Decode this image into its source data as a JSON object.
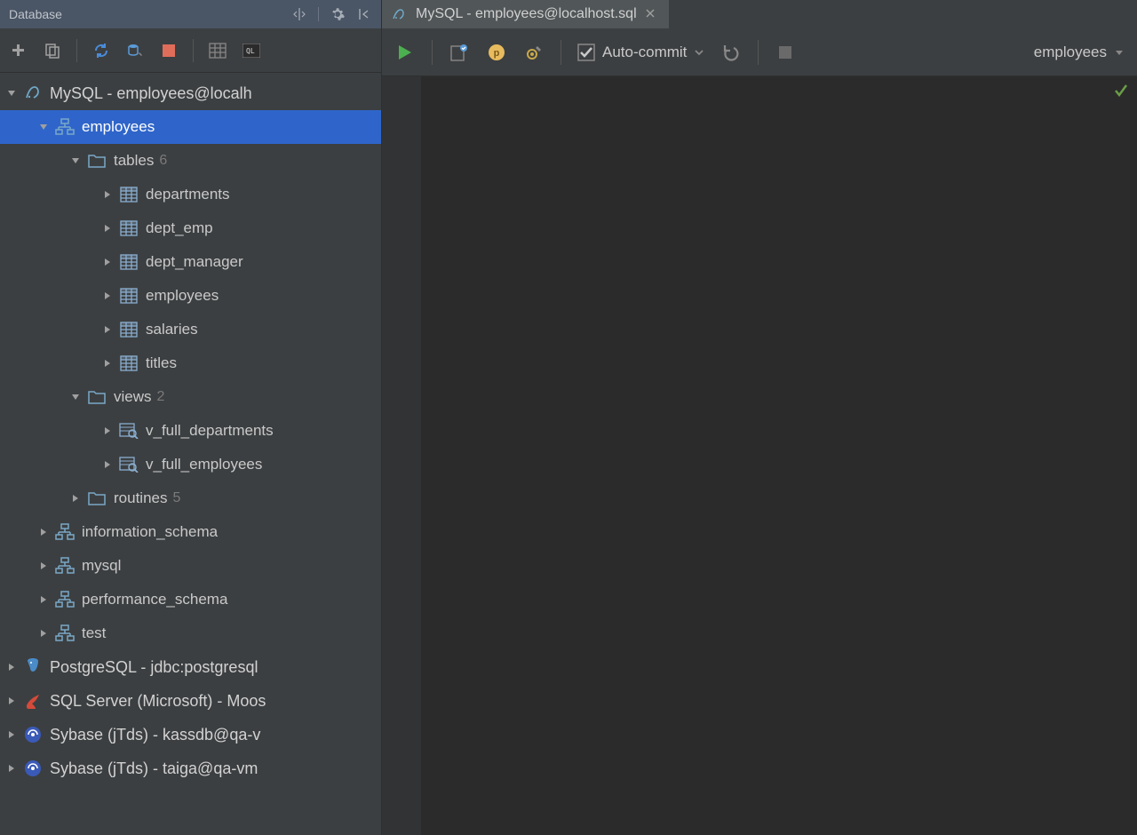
{
  "panel": {
    "title": "Database"
  },
  "tree": {
    "connections": [
      {
        "name": "MySQL - employees@localh",
        "icon": "mysql",
        "expanded": true,
        "schemas": [
          {
            "name": "employees",
            "selected": true,
            "expanded": true,
            "folders": [
              {
                "name": "tables",
                "count": "6",
                "expanded": true,
                "items": [
                  {
                    "name": "departments",
                    "type": "table"
                  },
                  {
                    "name": "dept_emp",
                    "type": "table"
                  },
                  {
                    "name": "dept_manager",
                    "type": "table"
                  },
                  {
                    "name": "employees",
                    "type": "table"
                  },
                  {
                    "name": "salaries",
                    "type": "table"
                  },
                  {
                    "name": "titles",
                    "type": "table"
                  }
                ]
              },
              {
                "name": "views",
                "count": "2",
                "expanded": true,
                "items": [
                  {
                    "name": "v_full_departments",
                    "type": "view"
                  },
                  {
                    "name": "v_full_employees",
                    "type": "view"
                  }
                ]
              },
              {
                "name": "routines",
                "count": "5",
                "expanded": false,
                "items": []
              }
            ]
          },
          {
            "name": "information_schema"
          },
          {
            "name": "mysql"
          },
          {
            "name": "performance_schema"
          },
          {
            "name": "test"
          }
        ]
      },
      {
        "name": "PostgreSQL - jdbc:postgresql",
        "icon": "postgres"
      },
      {
        "name": "SQL Server (Microsoft) - Moos",
        "icon": "sqlserver"
      },
      {
        "name": "Sybase (jTds) - kassdb@qa-v",
        "icon": "sybase"
      },
      {
        "name": "Sybase (jTds) - taiga@qa-vm",
        "icon": "sybase"
      }
    ]
  },
  "editor": {
    "tab_title": "MySQL - employees@localhost.sql",
    "auto_commit_label": "Auto-commit",
    "schema_label": "employees"
  }
}
